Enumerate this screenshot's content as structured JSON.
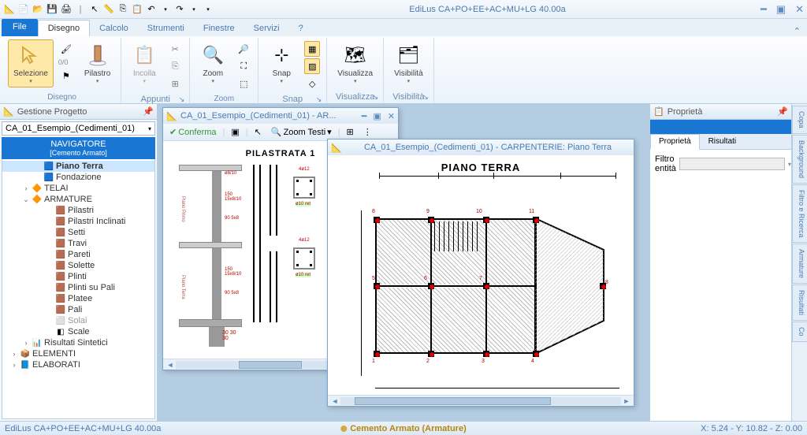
{
  "app": {
    "title": "EdiLus CA+PO+EE+AC+MU+LG 40.00a"
  },
  "ribbon": {
    "file": "File",
    "tabs": [
      "Disegno",
      "Calcolo",
      "Strumenti",
      "Finestre",
      "Servizi"
    ],
    "active_tab": 0,
    "help": "?",
    "groups": {
      "disegno": {
        "label": "Disegno",
        "selezione": "Selezione",
        "ratio": "0/0",
        "pilastro": "Pilastro"
      },
      "appunti": {
        "label": "Appunti",
        "incolla": "Incolla"
      },
      "zoom": {
        "label": "Zoom",
        "zoom": "Zoom"
      },
      "snap": {
        "label": "Snap",
        "snap": "Snap"
      },
      "visualizza": {
        "label": "Visualizza",
        "visualizza": "Visualizza"
      },
      "visibilita": {
        "label": "Visibilità",
        "visibilita": "Visibilità"
      }
    }
  },
  "left_panel": {
    "title": "Gestione Progetto",
    "combo": "CA_01_Esempio_(Cedimenti_01)",
    "navigator": {
      "title": "NAVIGATORE",
      "subtitle": "[Cemento Armato]"
    },
    "tree": [
      {
        "label": "Piano Terra",
        "icon": "🟦",
        "level": 1,
        "selected": true,
        "bold": true
      },
      {
        "label": "Fondazione",
        "icon": "🟦",
        "level": 1
      },
      {
        "label": "TELAI",
        "icon": "🔶",
        "level": 0,
        "exp": "›"
      },
      {
        "label": "ARMATURE",
        "icon": "🔶",
        "level": 0,
        "exp": "⌄"
      },
      {
        "label": "Pilastri",
        "icon": "🟫",
        "level": 2
      },
      {
        "label": "Pilastri Inclinati",
        "icon": "🟫",
        "level": 2
      },
      {
        "label": "Setti",
        "icon": "🟫",
        "level": 2
      },
      {
        "label": "Travi",
        "icon": "🟫",
        "level": 2
      },
      {
        "label": "Pareti",
        "icon": "🟫",
        "level": 2
      },
      {
        "label": "Solette",
        "icon": "🟫",
        "level": 2
      },
      {
        "label": "Plinti",
        "icon": "🟫",
        "level": 2
      },
      {
        "label": "Plinti su Pali",
        "icon": "🟫",
        "level": 2
      },
      {
        "label": "Platee",
        "icon": "🟫",
        "level": 2
      },
      {
        "label": "Pali",
        "icon": "🟫",
        "level": 2
      },
      {
        "label": "Solai",
        "icon": "⬜",
        "level": 2,
        "dim": true
      },
      {
        "label": "Scale",
        "icon": "◧",
        "level": 2
      },
      {
        "label": "Risultati Sintetici",
        "icon": "📊",
        "level": 0,
        "exp": "›"
      },
      {
        "label": "ELEMENTI",
        "icon": "📦",
        "level": -1,
        "exp": "›"
      },
      {
        "label": "ELABORATI",
        "icon": "📘",
        "level": -1,
        "exp": "›"
      }
    ]
  },
  "mdi": {
    "win1": {
      "title": "CA_01_Esempio_(Cedimenti_01) -  AR...",
      "toolbar": {
        "conferma": "Conferma",
        "zoom_testi": "Zoom Testi"
      },
      "drawing": {
        "title": "PILASTRATA 1",
        "dims": [
          "150  15x8/10",
          "150  15x8/10",
          "90  5x8",
          "90  5x8"
        ],
        "sections": [
          "4ø12",
          "4ø12"
        ],
        "rebar_labels": [
          "ø10 ret",
          "ø10 ret"
        ]
      }
    },
    "win2": {
      "title": "CA_01_Esempio_(Cedimenti_01) -  CARPENTERIE: Piano Terra",
      "drawing": {
        "title": "PIANO TERRA",
        "nodes": [
          "1",
          "2",
          "3",
          "4",
          "5",
          "6",
          "7",
          "8",
          "9",
          "10",
          "11"
        ]
      }
    }
  },
  "right_panel": {
    "title": "Proprietà",
    "tabs": [
      "Proprietà",
      "Risultati"
    ],
    "active_tab": 0,
    "filter_label": "Filtro entità"
  },
  "side_tabs": [
    "Copa",
    "Background",
    "Filtro e Ricerca",
    "Armature",
    "Risultati",
    "Co"
  ],
  "statusbar": {
    "left": "EdiLus CA+PO+EE+AC+MU+LG 40.00a",
    "center": "Cemento Armato (Armature)",
    "right": "X: 5.24 - Y: 10.82 - Z: 0.00"
  }
}
